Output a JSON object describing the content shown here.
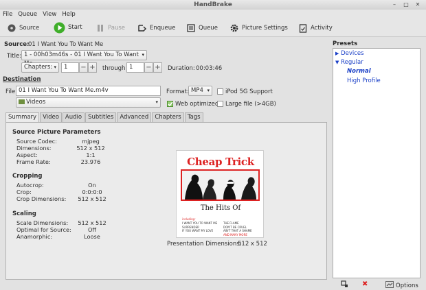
{
  "window": {
    "title": "HandBrake"
  },
  "menu": [
    "File",
    "Queue",
    "View",
    "Help"
  ],
  "toolbar": {
    "source": "Source",
    "start": "Start",
    "pause": "Pause",
    "enqueue": "Enqueue",
    "queue": "Queue",
    "picture_settings": "Picture Settings",
    "activity": "Activity"
  },
  "source": {
    "label": "Source:",
    "value": "01 I Want You To Want Me",
    "title_label": "Title:",
    "title_value": "1 - 00h03m46s - 01 I Want You To Want Me",
    "chapters_mode": "Chapters:",
    "chapter_from": "1",
    "through_label": "through",
    "chapter_to": "1",
    "duration_label": "Duration:",
    "duration_value": "00:03:46"
  },
  "destination": {
    "heading": "Destination",
    "file_label": "File:",
    "file_value": "01 I Want You To Want Me.m4v",
    "folder": "Videos",
    "format_label": "Format:",
    "format_value": "MP4",
    "ipod_label": "iPod 5G Support",
    "web_optimized_label": "Web optimized",
    "large_file_label": "Large file (>4GB)"
  },
  "tabs": [
    "Summary",
    "Video",
    "Audio",
    "Subtitles",
    "Advanced",
    "Chapters",
    "Tags"
  ],
  "summary": {
    "source_heading": "Source Picture Parameters",
    "source_rows": [
      {
        "k": "Source Codec:",
        "v": "mjpeg"
      },
      {
        "k": "Dimensions:",
        "v": "512 x 512"
      },
      {
        "k": "Aspect:",
        "v": "1:1"
      },
      {
        "k": "Frame Rate:",
        "v": "23.976"
      }
    ],
    "cropping_heading": "Cropping",
    "cropping_rows": [
      {
        "k": "Autocrop:",
        "v": "On"
      },
      {
        "k": "Crop:",
        "v": "0:0:0:0"
      },
      {
        "k": "Crop Dimensions:",
        "v": "512 x 512"
      }
    ],
    "scaling_heading": "Scaling",
    "scaling_rows": [
      {
        "k": "Scale Dimensions:",
        "v": "512 x 512"
      },
      {
        "k": "Optimal for Source:",
        "v": "Off"
      },
      {
        "k": "Anamorphic:",
        "v": "Loose"
      }
    ],
    "presentation_label": "Presentation Dimensions:",
    "presentation_value": "512 x 512"
  },
  "album": {
    "band": "Cheap Trick",
    "subtitle": "The Hits Of",
    "including": "including:",
    "tracks_left": [
      "I WANT YOU TO WANT ME",
      "SURRENDER",
      "IF YOU WANT MY LOVE"
    ],
    "tracks_right": [
      "THE FLAME",
      "DON'T BE CRUEL",
      "AIN'T THAT A SHAME",
      "AND MANY MORE"
    ]
  },
  "presets": {
    "heading": "Presets",
    "groups": [
      {
        "label": "Devices",
        "expanded": false
      },
      {
        "label": "Regular",
        "expanded": true
      }
    ],
    "items": [
      "Normal",
      "High Profile"
    ],
    "selected": "Normal",
    "options_label": "Options"
  },
  "colors": {
    "accent": "#1a3fc7",
    "start_green": "#3fae2a",
    "red": "#d22"
  }
}
